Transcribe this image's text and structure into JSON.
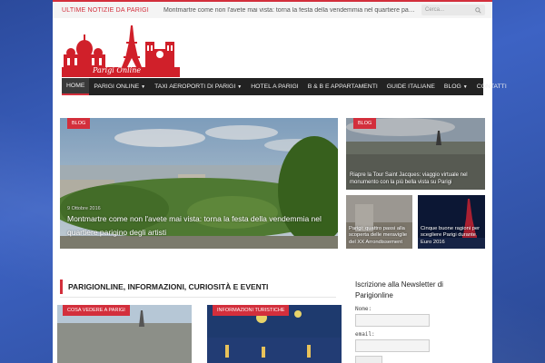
{
  "topbar": {
    "tag": "Ultime notizie da Parigi",
    "ticker": "Montmartre come non l'avete mai vista: torna la festa della vendemmia nel quartiere parigino degli artisti",
    "search_placeholder": "Cerca..."
  },
  "logo": {
    "text": "Parigi Online",
    "brand_color": "#d0202a"
  },
  "nav": [
    {
      "label": "Home",
      "active": true,
      "has_caret": false
    },
    {
      "label": "Parigi online",
      "has_caret": true
    },
    {
      "label": "Taxi aeroporti di Parigi",
      "has_caret": true
    },
    {
      "label": "Hotel a Parigi",
      "has_caret": false
    },
    {
      "label": "B & B e appartamenti",
      "has_caret": false
    },
    {
      "label": "Guide italiane",
      "has_caret": false
    },
    {
      "label": "Blog",
      "has_caret": true
    },
    {
      "label": "Contatti",
      "has_caret": false
    }
  ],
  "featured": {
    "main": {
      "badge": "Blog",
      "date": "9 Ottobre 2016",
      "title": "Montmartre come non l'avete mai vista: torna la festa della vendemmia nel quartiere parigino degli artisti"
    },
    "side": {
      "badge": "Blog",
      "title": "Riapre la Tour Saint Jacques: viaggio virtuale nel monumento con la più bella vista su Parigi"
    },
    "small1": {
      "title": "Parigi: quattro passi alla scoperta delle meraviglie del XX Arrondissement"
    },
    "small2": {
      "title": "Cinque buone ragioni per scegliere Parigi durante Euro 2016"
    }
  },
  "section": {
    "title": "Parigionline, informazioni, curiosità e eventi",
    "cards": [
      {
        "badge": "Cosa vedere a Parigi"
      },
      {
        "badge": "Informazioni turistiche"
      }
    ]
  },
  "newsletter": {
    "title": "Iscrizione alla Newsletter di Parigionline",
    "name_label": "Nome:",
    "email_label": "email:"
  },
  "colors": {
    "accent": "#d32f3c",
    "nav_bg": "#222222",
    "background": "#3d63c4"
  }
}
